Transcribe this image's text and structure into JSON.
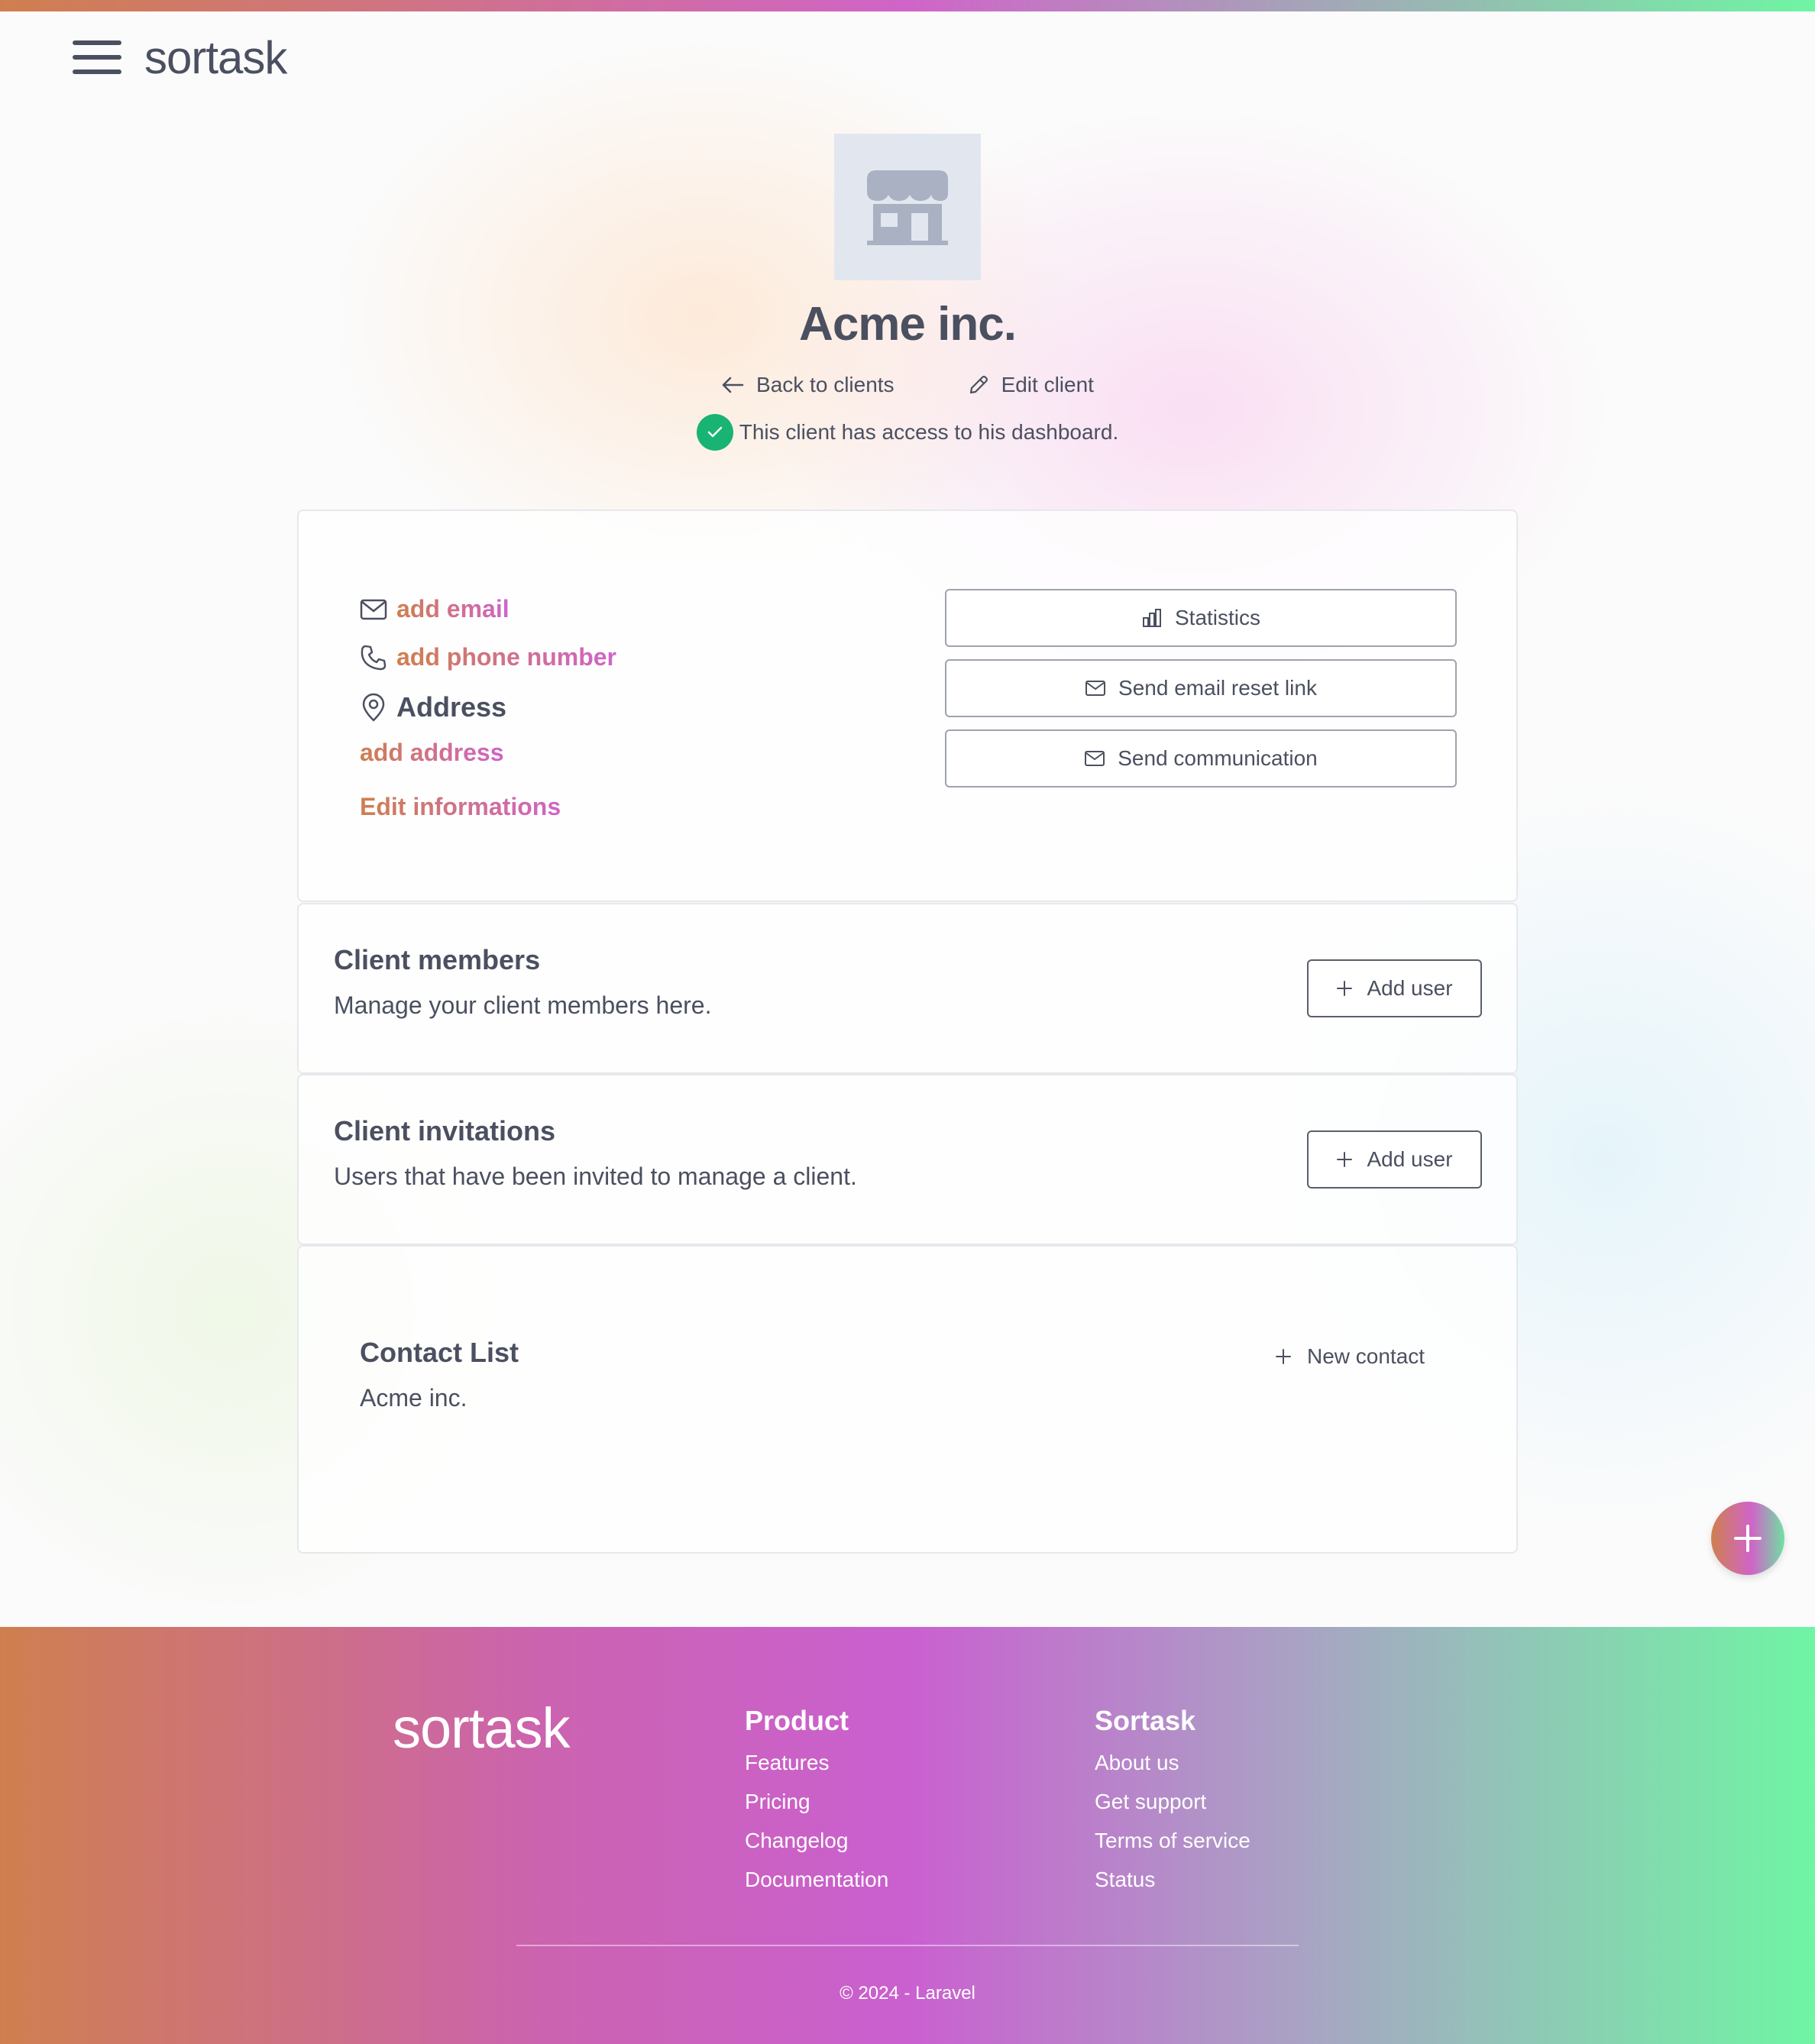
{
  "header": {
    "logo": "sortask",
    "menu_icon": "hamburger-menu-icon"
  },
  "client": {
    "name": "Acme inc.",
    "back_label": "Back to clients",
    "edit_label": "Edit client",
    "access_text": "This client has access to his dashboard.",
    "avatar_icon": "store-icon"
  },
  "info": {
    "email": "add email",
    "phone": "add phone number",
    "address_title": "Address",
    "address": "add address",
    "edit": "Edit informations",
    "buttons": {
      "statistics": "Statistics",
      "reset_link": "Send email reset link",
      "communication": "Send communication"
    }
  },
  "members": {
    "title": "Client members",
    "subtitle": "Manage your client members here.",
    "button": "Add user"
  },
  "invitations": {
    "title": "Client invitations",
    "subtitle": "Users that have been invited to manage a client.",
    "button": "Add user"
  },
  "contacts": {
    "title": "Contact List",
    "subtitle": "Acme inc.",
    "button": "New contact"
  },
  "footer": {
    "logo": "sortask",
    "product": {
      "title": "Product",
      "links": [
        "Features",
        "Pricing",
        "Changelog",
        "Documentation"
      ]
    },
    "company": {
      "title": "Sortask",
      "links": [
        "About us",
        "Get support",
        "Terms of service",
        "Status"
      ]
    },
    "copyright": "© 2024 - Laravel"
  },
  "colors": {
    "accent_start": "#cf7f4f",
    "accent_mid": "#d064c8",
    "accent_end": "#6ff5a3",
    "success": "#19b374",
    "text": "#4b5060"
  }
}
